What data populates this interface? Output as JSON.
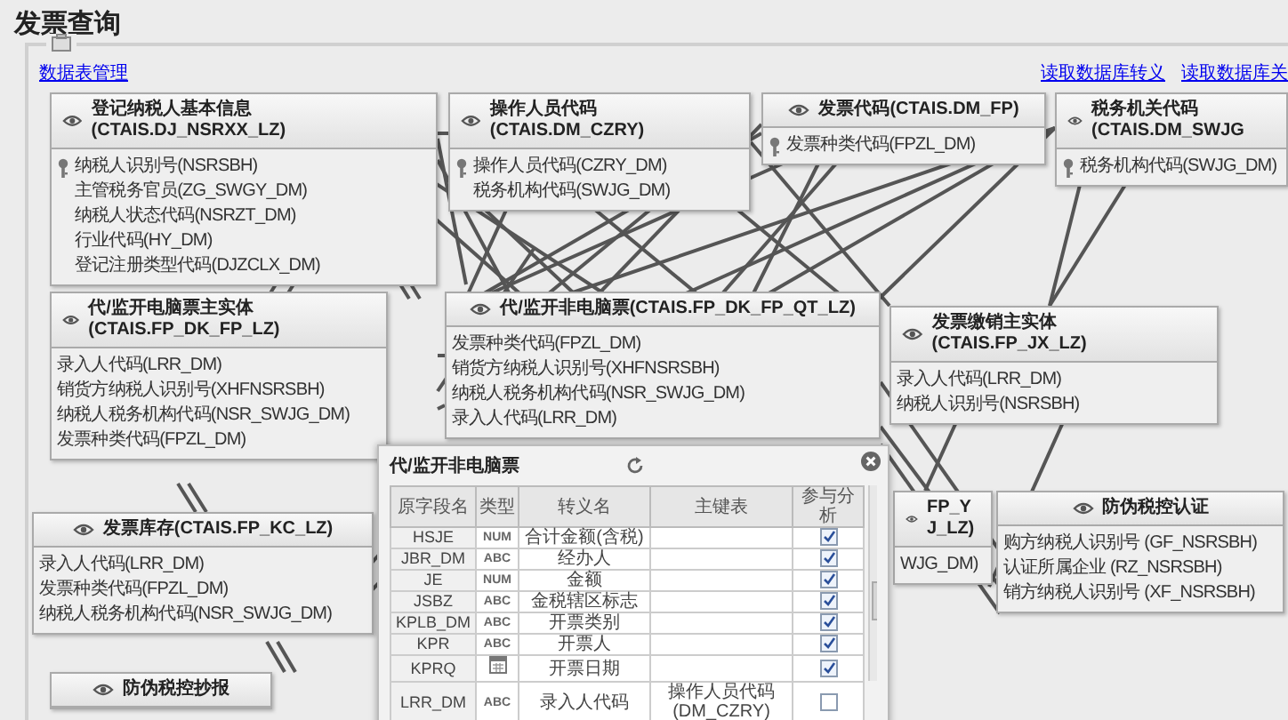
{
  "page": {
    "title": "发票查询"
  },
  "links": {
    "left": "数据表管理",
    "right": [
      "读取数据库转义",
      "读取数据库关"
    ]
  },
  "entities": [
    {
      "title": "登记纳税人基本信息(CTAIS.DJ_NSRXX_LZ)",
      "fields": [
        {
          "name": "纳税人识别号(NSRSBH)",
          "key": true
        },
        {
          "name": "主管税务官员(ZG_SWGY_DM)",
          "key": false
        },
        {
          "name": "纳税人状态代码(NSRZT_DM)",
          "key": false
        },
        {
          "name": "行业代码(HY_DM)",
          "key": false
        },
        {
          "name": "登记注册类型代码(DJZCLX_DM)",
          "key": false
        }
      ]
    },
    {
      "title": "操作人员代码(CTAIS.DM_CZRY)",
      "fields": [
        {
          "name": "操作人员代码(CZRY_DM)",
          "key": true
        },
        {
          "name": "税务机构代码(SWJG_DM)",
          "key": false
        }
      ]
    },
    {
      "title": "发票代码(CTAIS.DM_FP)",
      "fields": [
        {
          "name": "发票种类代码(FPZL_DM)",
          "key": true
        }
      ]
    },
    {
      "title": "税务机关代码(CTAIS.DM_SWJG",
      "fields": [
        {
          "name": "税务机构代码(SWJG_DM)",
          "key": true
        }
      ]
    },
    {
      "title": "代/监开电脑票主实体(CTAIS.FP_DK_FP_LZ)",
      "fields": [
        {
          "name": "录入人代码(LRR_DM)",
          "key": false
        },
        {
          "name": "销货方纳税人识别号(XHFNSRSBH)",
          "key": false
        },
        {
          "name": "纳税人税务机构代码(NSR_SWJG_DM)",
          "key": false
        },
        {
          "name": "发票种类代码(FPZL_DM)",
          "key": false
        }
      ]
    },
    {
      "title": "代/监开非电脑票(CTAIS.FP_DK_FP_QT_LZ)",
      "fields": [
        {
          "name": "发票种类代码(FPZL_DM)",
          "key": false
        },
        {
          "name": "销货方纳税人识别号(XHFNSRSBH)",
          "key": false
        },
        {
          "name": "纳税人税务机构代码(NSR_SWJG_DM)",
          "key": false
        },
        {
          "name": "录入人代码(LRR_DM)",
          "key": false
        }
      ]
    },
    {
      "title": "发票缴销主实体(CTAIS.FP_JX_LZ)",
      "fields": [
        {
          "name": "录入人代码(LRR_DM)",
          "key": false
        },
        {
          "name": "纳税人识别号(NSRSBH)",
          "key": false
        }
      ]
    },
    {
      "title": "发票库存(CTAIS.FP_KC_LZ)",
      "fields": [
        {
          "name": "录入人代码(LRR_DM)",
          "key": false
        },
        {
          "name": "发票种类代码(FPZL_DM)",
          "key": false
        },
        {
          "name": "纳税人税务机构代码(NSR_SWJG_DM)",
          "key": false
        }
      ]
    },
    {
      "title": "FP_YJ_LZ)",
      "fields": [
        {
          "name": "WJG_DM)",
          "key": false
        }
      ]
    },
    {
      "title": "防伪税控认证",
      "fields": [
        {
          "name": "购方纳税人识别号 (GF_NSRSBH)",
          "key": false
        },
        {
          "name": "认证所属企业 (RZ_NSRSBH)",
          "key": false
        },
        {
          "name": "销方纳税人识别号 (XF_NSRSBH)",
          "key": false
        }
      ]
    },
    {
      "title": "防伪税控抄报"
    }
  ],
  "dialog": {
    "title": "代/监开非电脑票",
    "columns": [
      "原字段名",
      "类型",
      "转义名",
      "主键表",
      "参与分析"
    ],
    "rows": [
      {
        "field": "HSJE",
        "kind": "num",
        "type": "NUM",
        "alias": "合计金额(含税)",
        "pk_table": "",
        "analyze": true
      },
      {
        "field": "JBR_DM",
        "kind": "abc",
        "type": "ABC",
        "alias": "经办人",
        "pk_table": "",
        "analyze": true
      },
      {
        "field": "JE",
        "kind": "num",
        "type": "NUM",
        "alias": "金额",
        "pk_table": "",
        "analyze": true
      },
      {
        "field": "JSBZ",
        "kind": "abc",
        "type": "ABC",
        "alias": "金税辖区标志",
        "pk_table": "",
        "analyze": true
      },
      {
        "field": "KPLB_DM",
        "kind": "abc",
        "type": "ABC",
        "alias": "开票类别",
        "pk_table": "",
        "analyze": true
      },
      {
        "field": "KPR",
        "kind": "abc",
        "type": "ABC",
        "alias": "开票人",
        "pk_table": "",
        "analyze": true
      },
      {
        "field": "KPRQ",
        "kind": "date",
        "alias": "开票日期",
        "pk_table": "",
        "analyze": true
      },
      {
        "field": "LRR_DM",
        "kind": "abc",
        "type": "ABC",
        "alias": "录入人代码",
        "pk_table": "操作人员代码(DM_CZRY)",
        "analyze": false
      }
    ]
  }
}
